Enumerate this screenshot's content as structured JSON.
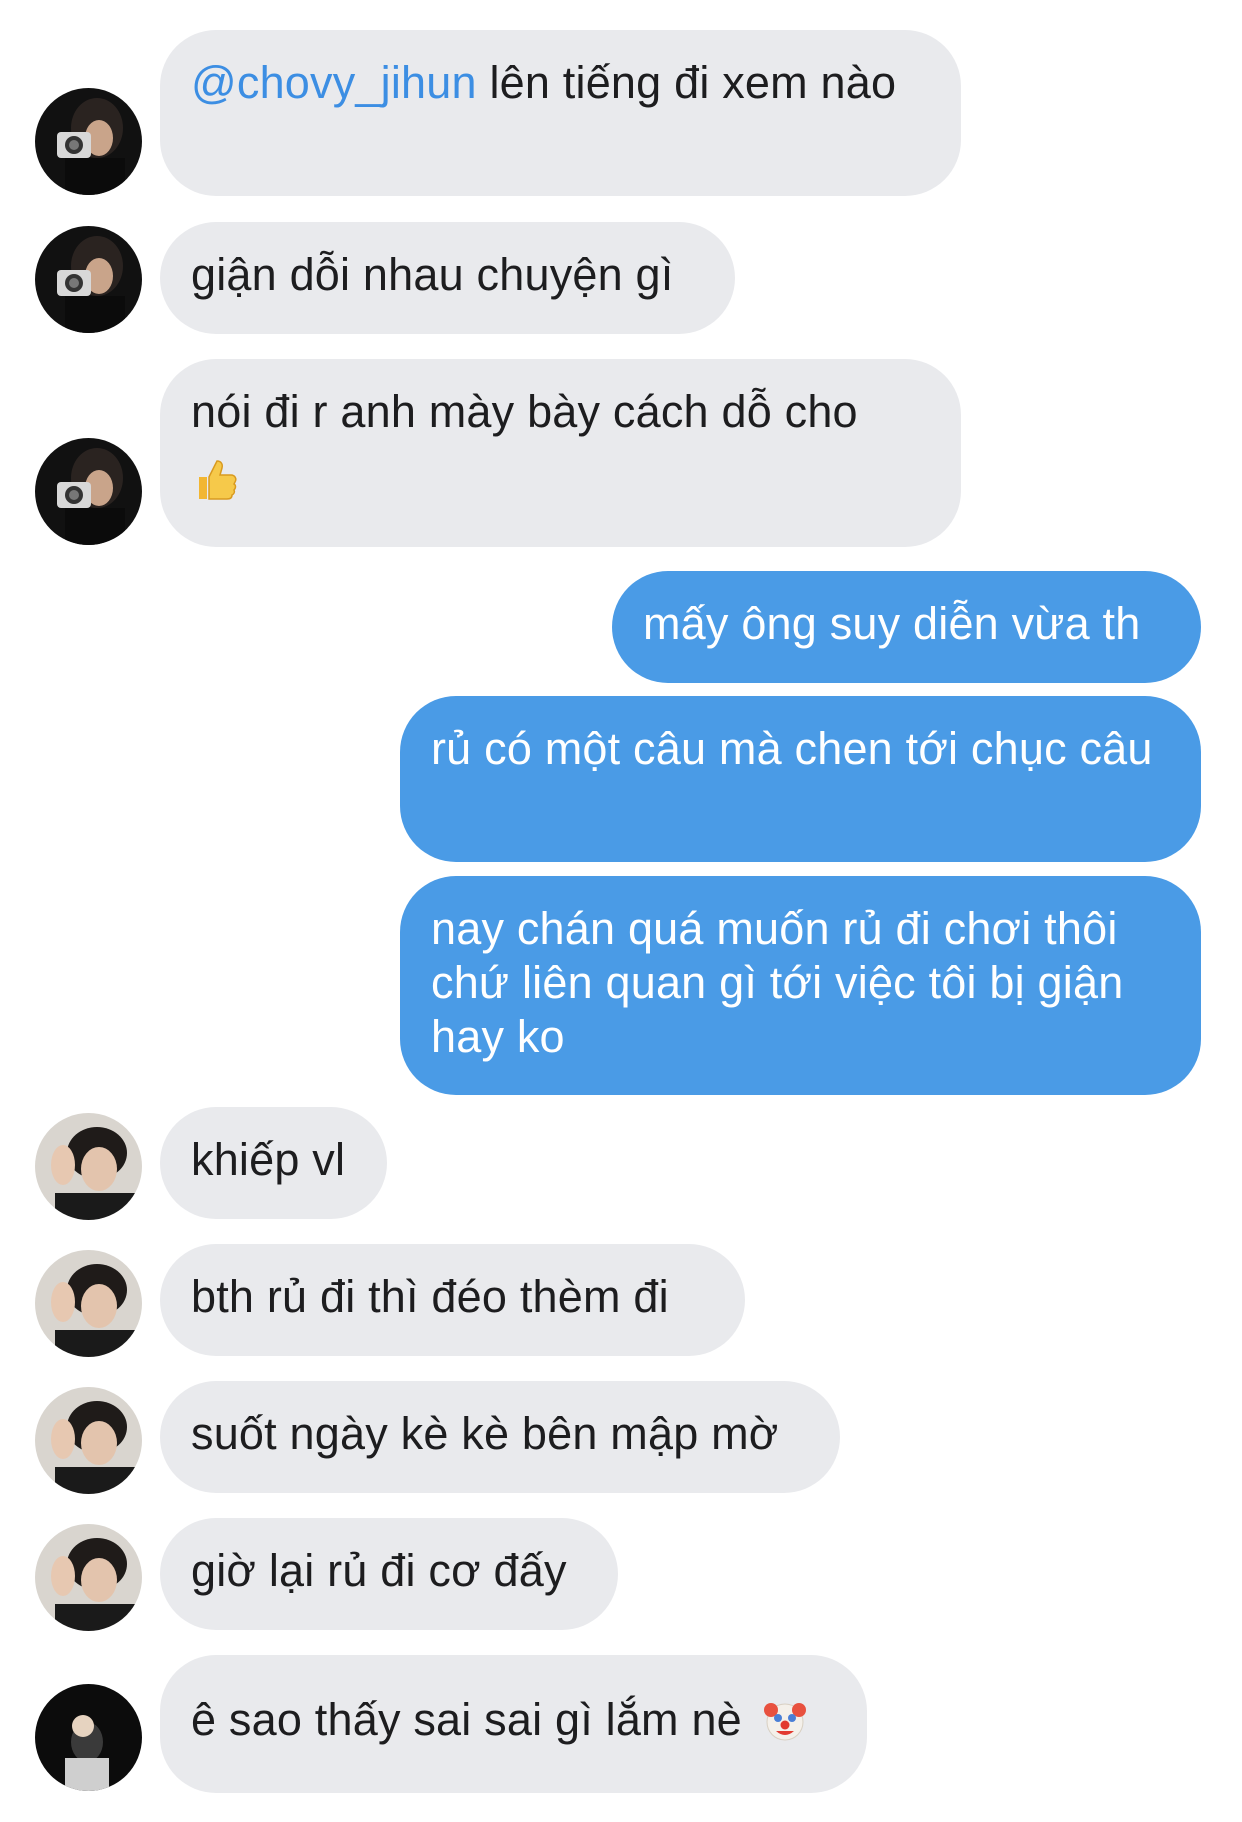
{
  "messages": [
    {
      "side": "in",
      "avatar": "avatar-a",
      "mention": "@chovy_jihun",
      "text": " lên tiếng đi xem nào"
    },
    {
      "side": "in",
      "avatar": "avatar-a",
      "text": "giận dỗi nhau chuyện gì"
    },
    {
      "side": "in",
      "avatar": "avatar-a",
      "text": "nói đi r anh mày bày cách dỗ cho",
      "emoji": "thumbs-up-icon"
    },
    {
      "side": "out",
      "text": "mấy ông suy diễn vừa th"
    },
    {
      "side": "out",
      "text": "rủ có một câu mà chen tới chục câu"
    },
    {
      "side": "out",
      "text": "nay chán quá muốn rủ đi chơi thôi chứ liên quan gì tới việc tôi bị giận hay ko"
    },
    {
      "side": "in",
      "avatar": "avatar-b",
      "text": "khiếp vl"
    },
    {
      "side": "in",
      "avatar": "avatar-b",
      "text": "bth rủ đi thì đéo thèm đi"
    },
    {
      "side": "in",
      "avatar": "avatar-b",
      "text": "suốt ngày kè kè bên mập mờ"
    },
    {
      "side": "in",
      "avatar": "avatar-b",
      "text": "giờ lại rủ đi cơ đấy"
    },
    {
      "side": "in",
      "avatar": "avatar-c",
      "text": "ê sao thấy sai sai gì lắm nè",
      "emoji": "clown-face-icon"
    }
  ],
  "colors": {
    "incoming_bubble": "#e9eaed",
    "outgoing_bubble": "#4a9be6",
    "mention": "#3c8ee3"
  }
}
